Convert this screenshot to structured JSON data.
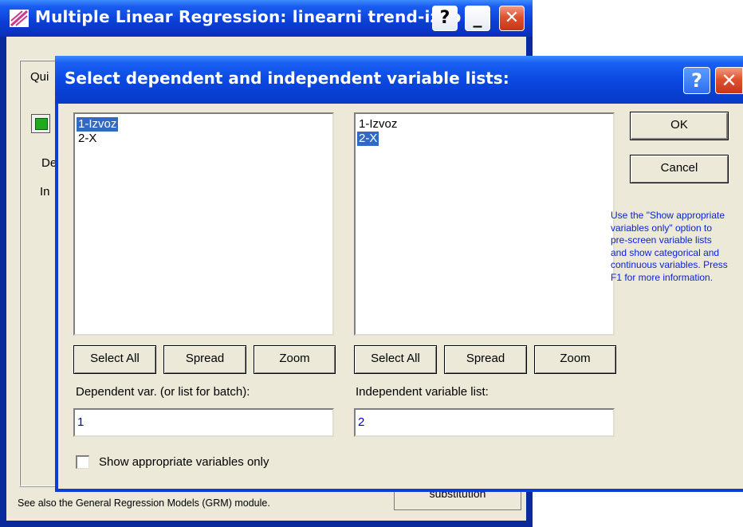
{
  "back_window": {
    "title": "Multiple Linear Regression: linearni trend-izvo",
    "help_glyph": "?",
    "minimize_glyph": "_",
    "close_glyph": "✕",
    "tab_label": "Qui",
    "label_1": "De",
    "label_2": "In",
    "footer_note": "See also the General Regression Models (GRM) module.",
    "button_label": "substitution"
  },
  "dialog": {
    "title": "Select dependent and independent variable lists:",
    "help_glyph": "?",
    "close_glyph": "✕",
    "dependent": {
      "items": [
        {
          "label": "1-Izvoz",
          "selected": true
        },
        {
          "label": "2-X",
          "selected": false
        }
      ],
      "select_all": "Select All",
      "spread": "Spread",
      "zoom": "Zoom",
      "field_label": "Dependent var. (or list for batch):",
      "field_value": "1"
    },
    "independent": {
      "items": [
        {
          "label": "1-Izvoz",
          "selected": false
        },
        {
          "label": "2-X",
          "selected": true
        }
      ],
      "select_all": "Select All",
      "spread": "Spread",
      "zoom": "Zoom",
      "field_label": "Independent variable list:",
      "field_value": "2"
    },
    "ok_label": "OK",
    "cancel_label": "Cancel",
    "hint_text": "Use the \"Show appropriate variables only\" option to pre-screen variable lists and show categorical and continuous variables. Press F1 for more information.",
    "checkbox_label": "Show appropriate variables only",
    "checkbox_checked": false
  }
}
